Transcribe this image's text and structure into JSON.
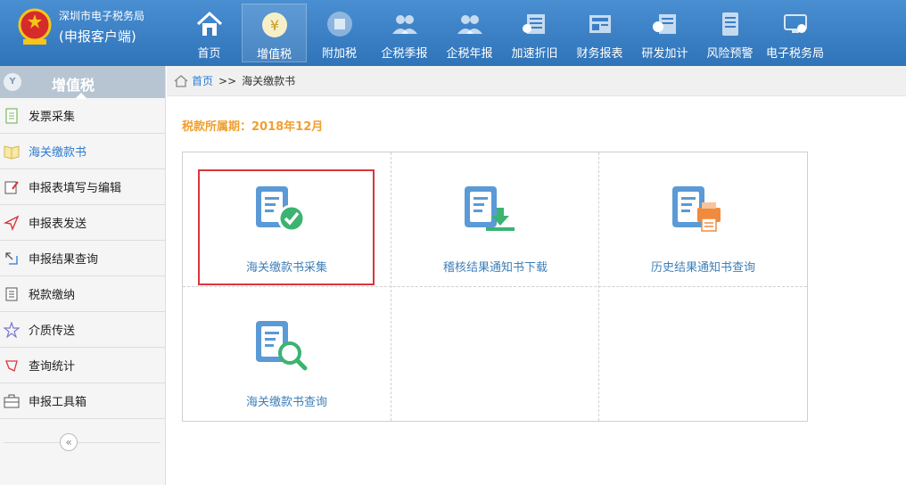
{
  "header": {
    "app_name": "深圳市电子税务局",
    "app_subtitle": "(申报客户端)",
    "nav": [
      {
        "label": "首页",
        "icon": "home-icon"
      },
      {
        "label": "增值税",
        "icon": "yuan-coin-icon"
      },
      {
        "label": "附加税",
        "icon": "coin-icon"
      },
      {
        "label": "企税季报",
        "icon": "users-icon"
      },
      {
        "label": "企税年报",
        "icon": "users-icon"
      },
      {
        "label": "加速折旧",
        "icon": "list-icon"
      },
      {
        "label": "财务报表",
        "icon": "report-icon"
      },
      {
        "label": "研发加计",
        "icon": "money-list-icon"
      },
      {
        "label": "风险预警",
        "icon": "document-icon"
      },
      {
        "label": "电子税务局",
        "icon": "monitor-icon"
      }
    ],
    "active_nav": "增值税"
  },
  "sidebar": {
    "title": "增值税",
    "items": [
      {
        "label": "发票采集",
        "icon": "document-icon"
      },
      {
        "label": "海关缴款书",
        "icon": "book-icon"
      },
      {
        "label": "申报表填写与编辑",
        "icon": "edit-icon"
      },
      {
        "label": "申报表发送",
        "icon": "send-icon"
      },
      {
        "label": "申报结果查询",
        "icon": "result-search-icon"
      },
      {
        "label": "税款缴纳",
        "icon": "list-icon"
      },
      {
        "label": "介质传送",
        "icon": "star-icon"
      },
      {
        "label": "查询统计",
        "icon": "stats-icon"
      },
      {
        "label": "申报工具箱",
        "icon": "toolbox-icon"
      }
    ],
    "active_item": "海关缴款书",
    "collapse_symbol": "«"
  },
  "breadcrumb": {
    "home": "首页",
    "separator": ">>",
    "current": "海关缴款书"
  },
  "main": {
    "period_label": "税款所属期：2018年12月",
    "tiles": [
      {
        "label": "海关缴款书采集",
        "icon": "doc-check-icon"
      },
      {
        "label": "稽核结果通知书下载",
        "icon": "doc-download-icon"
      },
      {
        "label": "历史结果通知书查询",
        "icon": "doc-print-icon"
      },
      {
        "label": "海关缴款书查询",
        "icon": "doc-search-icon"
      }
    ]
  },
  "colors": {
    "header_blue": "#3a7fc4",
    "tile_label_blue": "#3f7fb8",
    "period_orange": "#f0a030",
    "highlight_red": "#d9363e",
    "icon_green": "#3cb371"
  }
}
